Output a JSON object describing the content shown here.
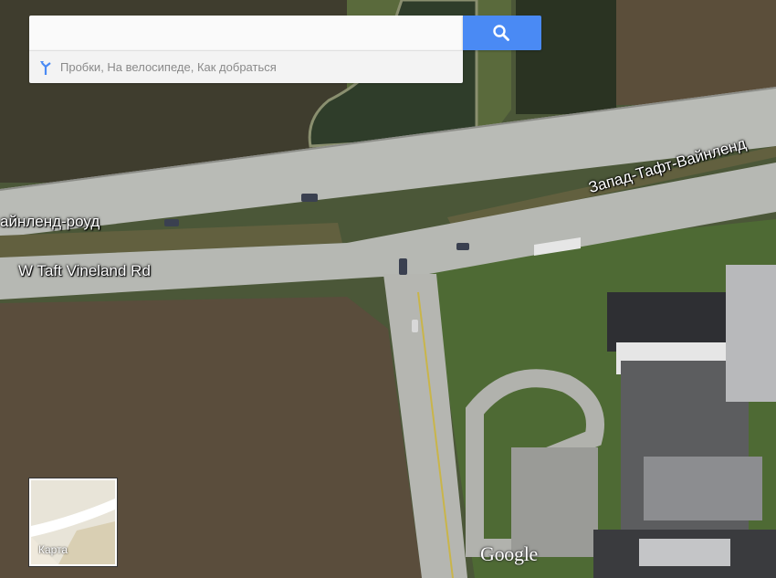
{
  "search": {
    "value": "",
    "placeholder": "",
    "button_icon": "search-icon"
  },
  "suggestions": {
    "icon": "directions-icon",
    "text": "Пробки, На велосипеде, Как добраться"
  },
  "road_labels": [
    "айнленд-роуд",
    "W Taft Vineland Rd",
    "Запад-Тафт-Вайнленд"
  ],
  "minimap": {
    "label": "Карта"
  },
  "logo": "Google",
  "colors": {
    "search_button": "#4a8af4",
    "field": "#4f5b3c",
    "road": "#b9bbb6"
  }
}
